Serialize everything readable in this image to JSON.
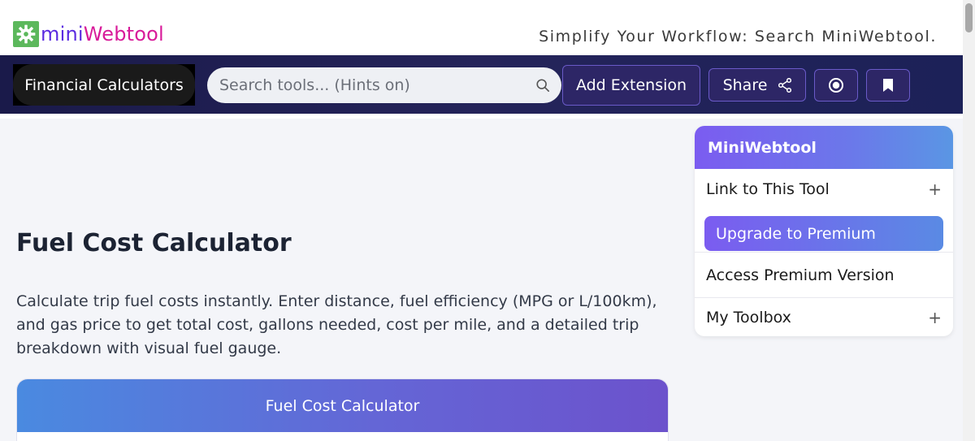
{
  "header": {
    "logo_part1": "mini",
    "logo_part2": "Webtool",
    "logo_icon": "gear-icon",
    "tagline": "Simplify Your Workflow: Search MiniWebtool."
  },
  "navbar": {
    "category_label": "Financial Calculators",
    "search_placeholder": "Search tools... (Hints on)",
    "search_icon": "search-icon",
    "add_extension_label": "Add Extension",
    "share_label": "Share",
    "share_icon": "share-icon",
    "record_icon": "record-icon",
    "bookmark_icon": "bookmark-icon"
  },
  "main": {
    "title": "Fuel Cost Calculator",
    "description": "Calculate trip fuel costs instantly. Enter distance, fuel efficiency (MPG or L/100km), and gas price to get total cost, gallons needed, cost per mile, and a detailed trip breakdown with visual fuel gauge.",
    "card_title": "Fuel Cost Calculator"
  },
  "sidebar": {
    "title": "MiniWebtool",
    "link_label": "Link to This Tool",
    "upgrade_label": "Upgrade to Premium",
    "access_label": "Access Premium Version",
    "toolbox_label": "My Toolbox",
    "expand_symbol": "+"
  },
  "colors": {
    "navbar_bg": "#1a1a4a",
    "accent_purple": "#7b5cf0",
    "accent_blue": "#4a8ae0",
    "logo_green": "#5cb85c",
    "logo_mini": "#5b2be0",
    "logo_web": "#d81b9a"
  }
}
